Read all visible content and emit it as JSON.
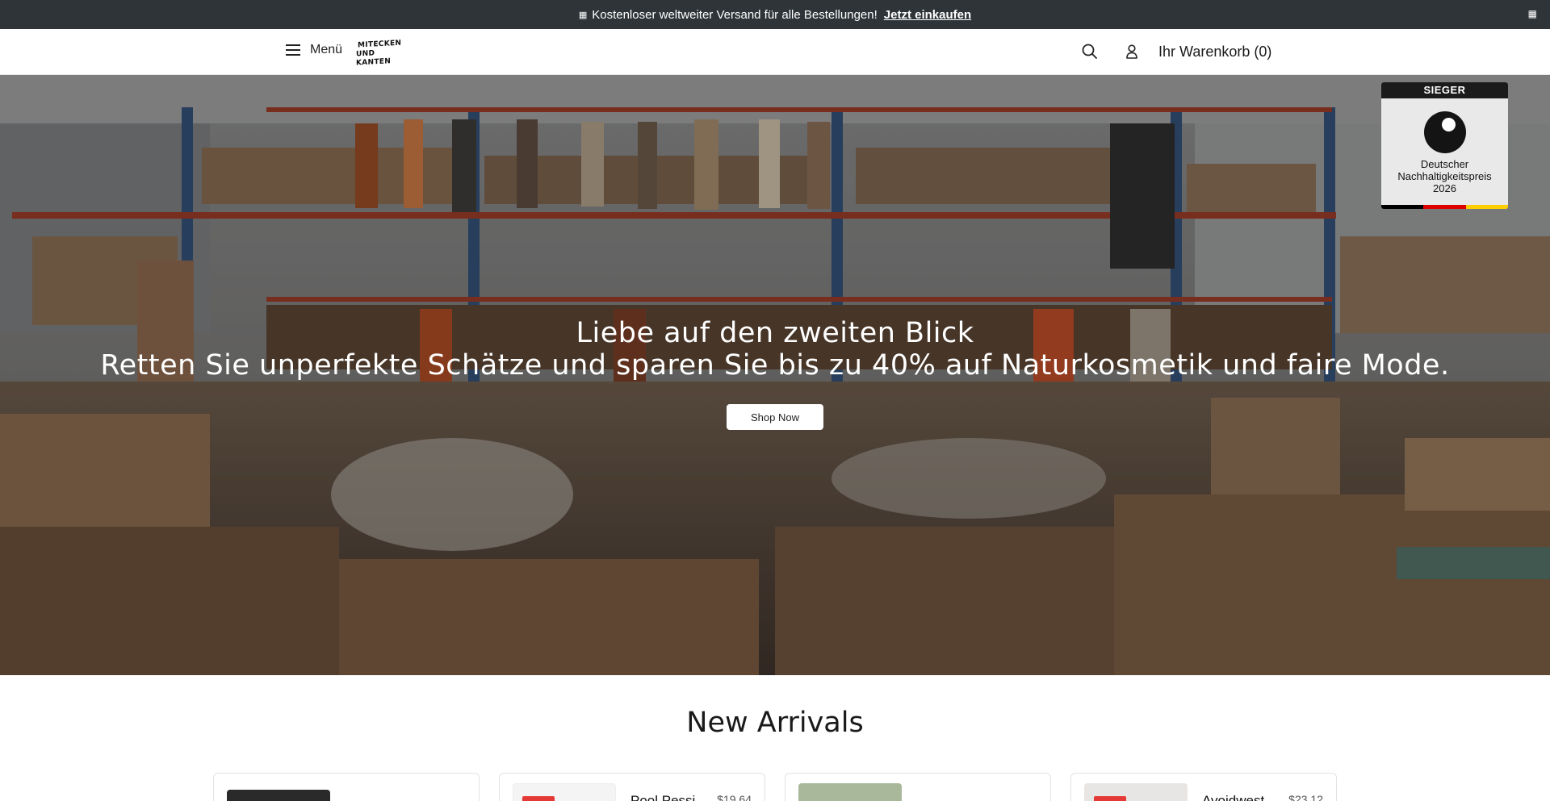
{
  "announcement": {
    "icon": "gift-icon",
    "text": "Kostenloser weltweiter Versand für alle Bestellungen!",
    "link_label": "Jetzt einkaufen",
    "close_icon": "close-icon"
  },
  "header": {
    "menu_label": "Menü",
    "logo_line1": "Mitecken",
    "logo_line2": "und Kanten",
    "search_icon": "search-icon",
    "account_icon": "user-icon",
    "cart_label": "Ihr Warenkorb (0)"
  },
  "hero": {
    "heading": "Liebe auf den zweiten Blick",
    "subheading": "Retten Sie unperfekte Schätze und sparen Sie bis zu 40% auf Naturkosmetik und faire Mode.",
    "button_label": "Shop Now",
    "award": {
      "header": "SIEGER",
      "line1": "Deutscher",
      "line2": "Nachhaltigkeitspreis",
      "line3": "2026"
    }
  },
  "new_arrivals": {
    "title": "New Arrivals",
    "products": [
      {
        "name": "",
        "price": "",
        "thumb_color": "#2a2a2a",
        "has_tag": false
      },
      {
        "name": "Pool Pessi",
        "price": "$19.64",
        "thumb_color": "#f4f4f4",
        "has_tag": true
      },
      {
        "name": "",
        "price": "",
        "thumb_color": "#a9b79a",
        "has_tag": false
      },
      {
        "name": "Avoidwest",
        "price": "$23.12",
        "thumb_color": "#e8e6e4",
        "has_tag": true
      }
    ]
  },
  "colors": {
    "announcement_bg": "#2e3438",
    "sale_tag": "#e53935",
    "flag_black": "#000000",
    "flag_red": "#dd0000",
    "flag_gold": "#ffce00"
  }
}
